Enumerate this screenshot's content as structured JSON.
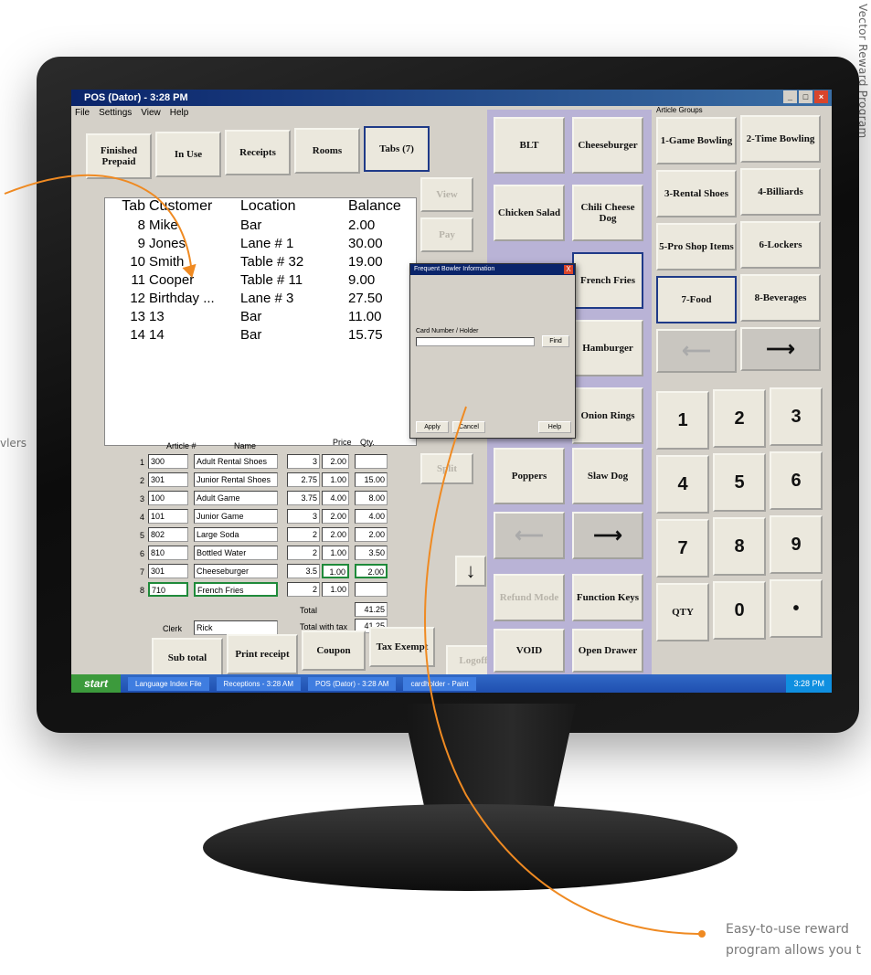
{
  "side_text": "Vector Reward Program",
  "left_fragment": "vlers",
  "caption": {
    "line1": "Easy-to-use reward",
    "line2": "program allows you t"
  },
  "window": {
    "title": "POS (Dator) - 3:28 PM",
    "menu": [
      "File",
      "Settings",
      "View",
      "Help"
    ]
  },
  "top_buttons": [
    "Finished Prepaid",
    "In Use",
    "Receipts",
    "Rooms",
    "Tabs (7)"
  ],
  "tabs_list": {
    "headers": [
      "Tab",
      "Customer",
      "Location",
      "Balance"
    ],
    "rows": [
      {
        "tab": "8",
        "customer": "Mike",
        "location": "Bar",
        "balance": "2.00"
      },
      {
        "tab": "9",
        "customer": "Jones",
        "location": "Lane # 1",
        "balance": "30.00"
      },
      {
        "tab": "10",
        "customer": "Smith",
        "location": "Table # 32",
        "balance": "19.00"
      },
      {
        "tab": "11",
        "customer": "Cooper",
        "location": "Table # 11",
        "balance": "9.00"
      },
      {
        "tab": "12",
        "customer": "Birthday ...",
        "location": "Lane # 3",
        "balance": "27.50"
      },
      {
        "tab": "13",
        "customer": "13",
        "location": "Bar",
        "balance": "11.00"
      },
      {
        "tab": "14",
        "customer": "14",
        "location": "Bar",
        "balance": "15.75"
      }
    ]
  },
  "side_buttons": {
    "view": "View",
    "pay": "Pay",
    "split": "Split",
    "logoff": "Logoff"
  },
  "article_grid": {
    "headers": {
      "article": "Article #",
      "name": "Name",
      "price": "Price",
      "qty": "Qty."
    },
    "rows": [
      {
        "n": "1",
        "article": "300",
        "name": "Adult Rental Shoes",
        "price": "3",
        "qty": "2.00",
        "total": ""
      },
      {
        "n": "2",
        "article": "301",
        "name": "Junior Rental Shoes",
        "price": "2.75",
        "qty": "1.00",
        "total": "15.00"
      },
      {
        "n": "3",
        "article": "100",
        "name": "Adult Game",
        "price": "3.75",
        "qty": "4.00",
        "total": "8.00"
      },
      {
        "n": "4",
        "article": "101",
        "name": "Junior Game",
        "price": "3",
        "qty": "2.00",
        "total": "4.00"
      },
      {
        "n": "5",
        "article": "802",
        "name": "Large Soda",
        "price": "2",
        "qty": "2.00",
        "total": "2.00"
      },
      {
        "n": "6",
        "article": "810",
        "name": "Bottled Water",
        "price": "2",
        "qty": "1.00",
        "total": "3.50"
      },
      {
        "n": "7",
        "article": "301",
        "name": "Cheeseburger",
        "price": "3.5",
        "qty": "1.00",
        "total": "2.00"
      },
      {
        "n": "8",
        "article": "710",
        "name": "French Fries",
        "price": "2",
        "qty": "1.00",
        "total": ""
      }
    ],
    "total_label": "Total",
    "total_value": "41.25",
    "total_with_tax_label": "Total with tax",
    "total_with_tax_value": "41.25",
    "clerk_label": "Clerk",
    "clerk_value": "Rick"
  },
  "bottom_buttons": [
    "Sub total",
    "Print receipt",
    "Coupon",
    "Tax Exempt"
  ],
  "menu_items": [
    "BLT",
    "Cheeseburger",
    "Chicken Salad",
    "Chili Cheese Dog",
    "French Fries",
    "Hamburger",
    "Onion Rings",
    "Poppers",
    "Slaw Dog",
    "Refund Mode",
    "Function Keys",
    "VOID",
    "Open Drawer"
  ],
  "article_groups": {
    "label": "Article Groups",
    "items": [
      "1-Game Bowling",
      "2-Time Bowling",
      "3-Rental Shoes",
      "4-Billiards",
      "5-Pro Shop Items",
      "6-Lockers",
      "7-Food",
      "8-Beverages"
    ]
  },
  "keypad": [
    "1",
    "2",
    "3",
    "4",
    "5",
    "6",
    "7",
    "8",
    "9",
    "QTY",
    "0",
    "•"
  ],
  "taskbar": {
    "start": "start",
    "tasks": [
      "Language Index File",
      "Receptions - 3:28 AM",
      "POS (Dator) - 3:28 AM",
      "cardholder - Paint"
    ],
    "clock": "3:28 PM"
  },
  "dialog": {
    "title": "Frequent Bowler Information",
    "close": "X",
    "card_label": "Card Number / Holder",
    "find": "Find",
    "ok": "Apply",
    "cancel": "Cancel",
    "help": "Help"
  }
}
